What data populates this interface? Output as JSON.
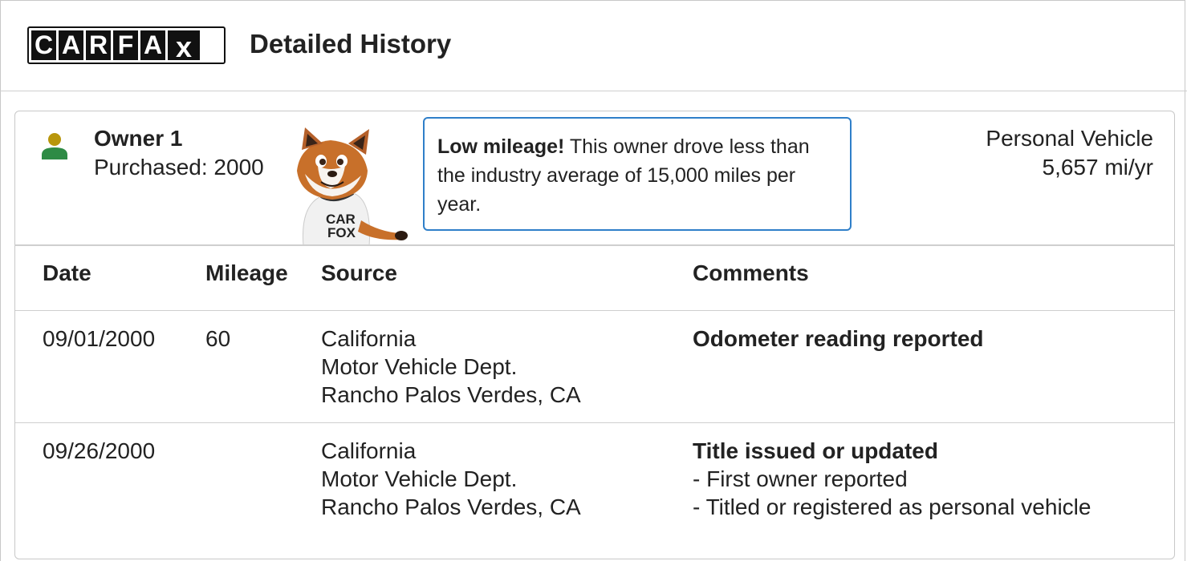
{
  "header": {
    "logo_letters": [
      "C",
      "A",
      "R",
      "F",
      "A",
      "x"
    ],
    "title": "Detailed History"
  },
  "owner": {
    "icon": "person-icon",
    "name": "Owner 1",
    "purchased": "Purchased: 2000",
    "notice_bold": "Low mileage!",
    "notice_text": " This owner drove less than the industry average of 15,000 miles per year.",
    "vehicle_type": "Personal Vehicle",
    "miles_per_year": "5,657 mi/yr",
    "colors": {
      "icon_head": "#b8960c",
      "icon_body": "#2e8b45",
      "notice_border": "#2f7fc9"
    }
  },
  "table": {
    "headers": {
      "date": "Date",
      "mileage": "Mileage",
      "source": "Source",
      "comments": "Comments"
    },
    "rows": [
      {
        "date": "09/01/2000",
        "mileage": "60",
        "source": [
          "California",
          "Motor Vehicle Dept.",
          "Rancho Palos Verdes, CA"
        ],
        "comment_title": "Odometer reading reported",
        "comment_lines": []
      },
      {
        "date": "09/26/2000",
        "mileage": "",
        "source": [
          "California",
          "Motor Vehicle Dept.",
          "Rancho Palos Verdes, CA"
        ],
        "comment_title": "Title issued or updated",
        "comment_lines": [
          "- First owner reported",
          "- Titled or registered as personal vehicle"
        ]
      }
    ]
  }
}
